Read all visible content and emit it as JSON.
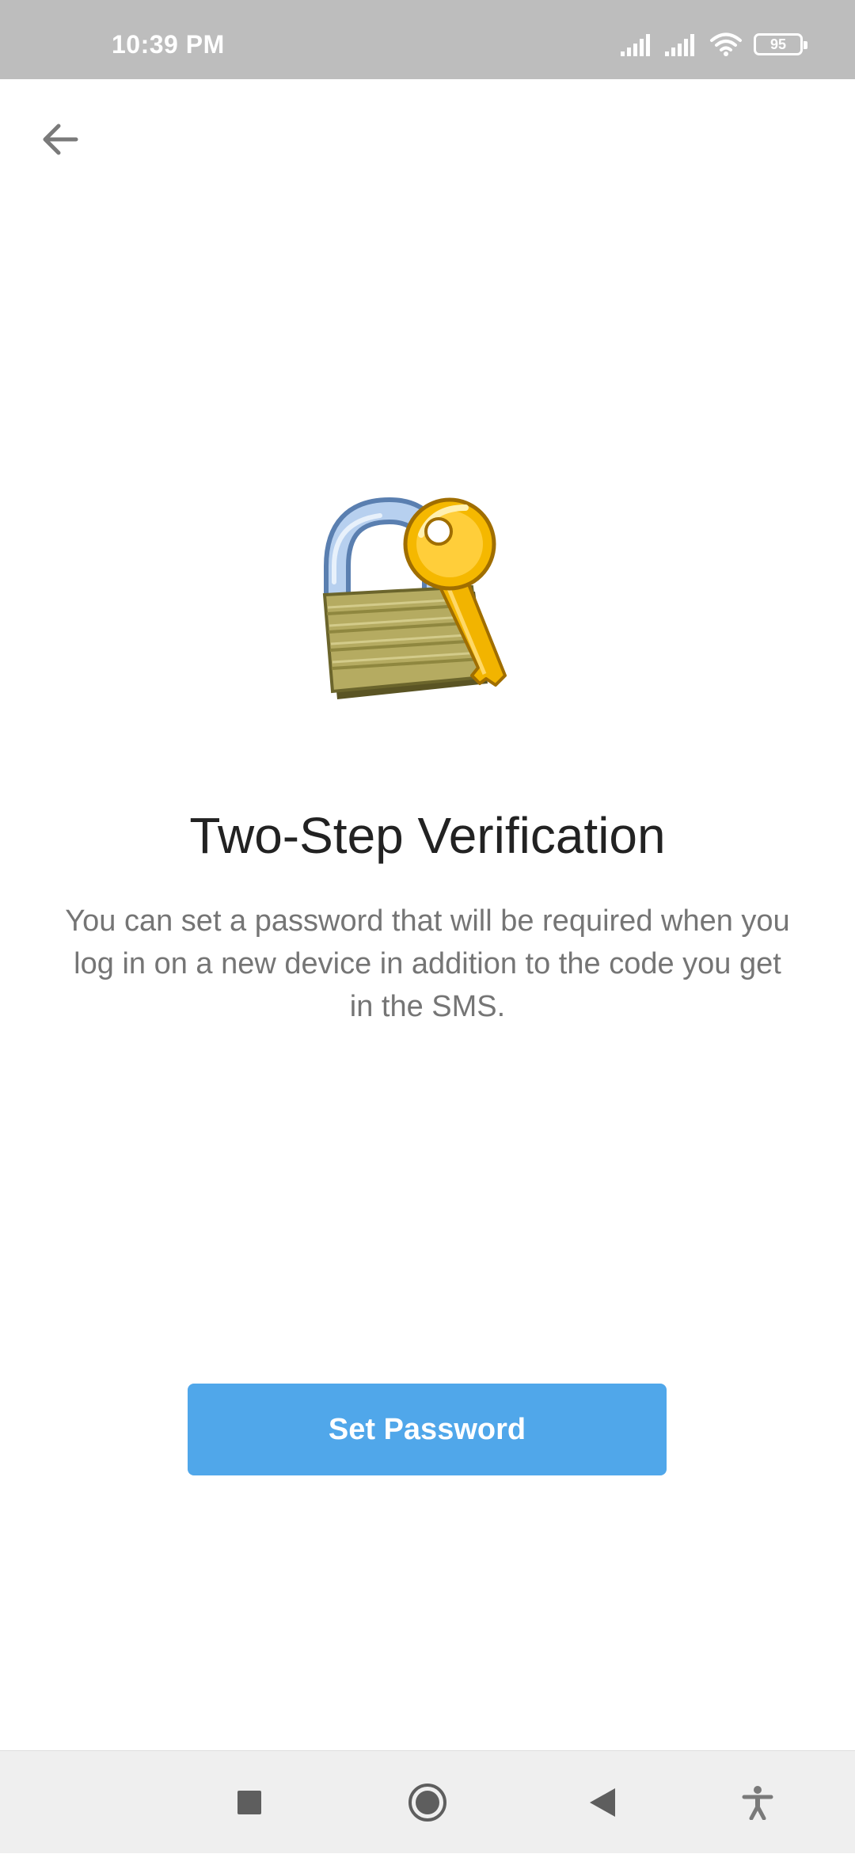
{
  "status_bar": {
    "time": "10:39 PM",
    "battery_level": "95"
  },
  "header": {
    "back_icon": "arrow-left-icon"
  },
  "content": {
    "title": "Two-Step Verification",
    "description": "You can set a password that will be required when you log in on a new device in addition to the code you get in the SMS."
  },
  "actions": {
    "set_password_label": "Set Password"
  },
  "nav_bar": {
    "icons": [
      "square-recents-icon",
      "circle-home-icon",
      "triangle-back-icon",
      "accessibility-icon"
    ]
  },
  "colors": {
    "accent": "#50a7ea",
    "status_bar": "#bdbdbd",
    "title": "#222222",
    "body_text": "#757575"
  }
}
